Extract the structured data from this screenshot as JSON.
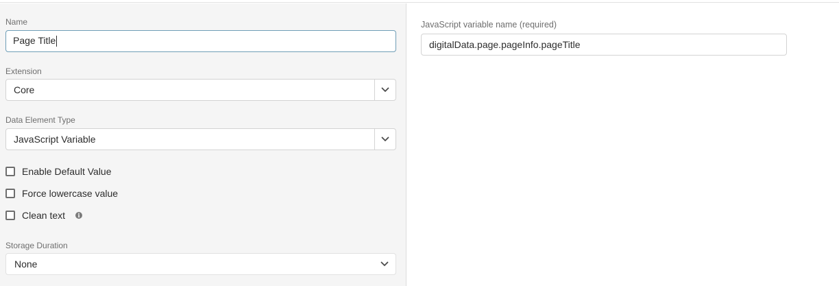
{
  "form": {
    "name": {
      "label": "Name",
      "value": "Page Title"
    },
    "extension": {
      "label": "Extension",
      "value": "Core"
    },
    "data_element_type": {
      "label": "Data Element Type",
      "value": "JavaScript Variable"
    },
    "checkboxes": [
      {
        "label": "Enable Default Value",
        "checked": false
      },
      {
        "label": "Force lowercase value",
        "checked": false
      },
      {
        "label": "Clean text",
        "checked": false
      }
    ],
    "storage_duration": {
      "label": "Storage Duration",
      "value": "None"
    }
  },
  "settings": {
    "variable_name": {
      "label": "JavaScript variable name (required)",
      "value": "digitalData.page.pageInfo.pageTitle"
    }
  },
  "icons": {
    "chevron": "chevron-down-icon",
    "info": "info-icon"
  }
}
